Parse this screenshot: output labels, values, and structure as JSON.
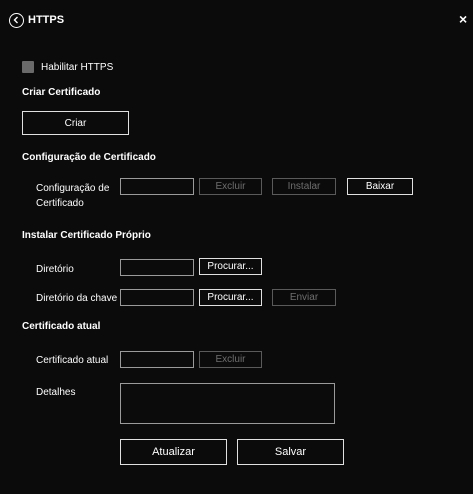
{
  "header": {
    "title": "HTTPS",
    "close_label": "×"
  },
  "enable": {
    "label": "Habilitar HTTPS",
    "checked": false
  },
  "create": {
    "section_title": "Criar Certificado",
    "button_label": "Criar"
  },
  "config": {
    "section_title": "Configuração de Certificado",
    "field_label_line1": "Configuração de",
    "field_label_line2": "Certificado",
    "field_value": "",
    "delete_label": "Excluir",
    "install_label": "Instalar",
    "download_label": "Baixar"
  },
  "own": {
    "section_title": "Instalar Certificado Próprio",
    "dir_label": "Diretório",
    "dir_value": "",
    "dir_browse_label": "Procurar...",
    "key_label": "Diretório da chave",
    "key_value": "",
    "key_browse_label": "Procurar...",
    "send_label": "Enviar"
  },
  "current": {
    "section_title": "Certificado atual",
    "field_label": "Certificado atual",
    "field_value": "",
    "delete_label": "Excluir",
    "details_label": "Detalhes",
    "details_value": ""
  },
  "footer": {
    "refresh_label": "Atualizar",
    "save_label": "Salvar"
  },
  "colors": {
    "background": "#0b0b0b",
    "text": "#ffffff",
    "disabled": "#6e6e6e",
    "checkbox": "#6a6a6a"
  }
}
